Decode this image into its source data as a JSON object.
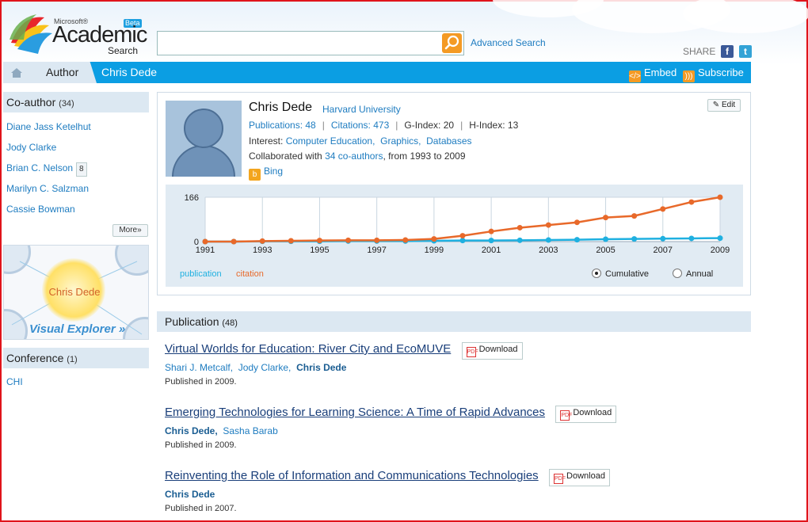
{
  "header": {
    "logo_ms": "Microsoft®",
    "logo_academic": "Academic",
    "logo_search": "Search",
    "logo_beta": "Beta",
    "search_value": "",
    "advanced_search": "Advanced Search",
    "share_label": "SHARE"
  },
  "nav": {
    "author": "Author",
    "current": "Chris Dede",
    "embed": "Embed",
    "subscribe": "Subscribe"
  },
  "sidebar": {
    "coauthor_title": "Co-author",
    "coauthor_count": "(34)",
    "coauthors": [
      {
        "name": "Diane Jass Ketelhut",
        "badge": ""
      },
      {
        "name": "Jody Clarke",
        "badge": ""
      },
      {
        "name": "Brian C. Nelson",
        "badge": "8"
      },
      {
        "name": "Marilyn C. Salzman",
        "badge": ""
      },
      {
        "name": "Cassie Bowman",
        "badge": ""
      }
    ],
    "more": "More»",
    "visual_center": "Chris Dede",
    "visual_label": "Visual Explorer »",
    "conference_title": "Conference",
    "conference_count": "(1)",
    "conference": "CHI"
  },
  "profile": {
    "name": "Chris Dede",
    "affiliation": "Harvard University",
    "edit": "Edit",
    "publications": "Publications: 48",
    "citations": "Citations: 473",
    "g_index": "G-Index: 20",
    "h_index": "H-Index: 13",
    "interest_label": "Interest:",
    "interests": [
      "Computer Education,",
      "Graphics,",
      "Databases"
    ],
    "collab_prefix": "Collaborated with",
    "collab_link": "34 co-authors",
    "collab_suffix": ", from 1993 to 2009",
    "bing": "Bing"
  },
  "chart_data": {
    "type": "line",
    "x": [
      1991,
      1992,
      1993,
      1994,
      1995,
      1996,
      1997,
      1998,
      1999,
      2000,
      2001,
      2002,
      2003,
      2004,
      2005,
      2006,
      2007,
      2008,
      2009
    ],
    "x_ticks": [
      "1991",
      "1993",
      "1995",
      "1997",
      "1999",
      "2001",
      "2003",
      "2005",
      "2007",
      "2009"
    ],
    "y_ticks": [
      "166",
      "0"
    ],
    "ylim": [
      0,
      166
    ],
    "mode": "Cumulative",
    "series": [
      {
        "name": "publication",
        "color": "#1fb0e0",
        "values": [
          0,
          0,
          1,
          1,
          1,
          2,
          2,
          2,
          3,
          4,
          4,
          5,
          6,
          7,
          9,
          10,
          11,
          12,
          13
        ]
      },
      {
        "name": "citation",
        "color": "#e8692a",
        "values": [
          0,
          0,
          2,
          3,
          4,
          5,
          5,
          6,
          10,
          22,
          38,
          52,
          62,
          72,
          90,
          96,
          122,
          148,
          166
        ]
      }
    ],
    "legend": [
      "publication",
      "citation"
    ],
    "options": [
      "Cumulative",
      "Annual"
    ],
    "grid": true
  },
  "publication": {
    "title": "Publication",
    "count": "(48)",
    "download": "Download",
    "items": [
      {
        "title": "Virtual Worlds for Education: River City and EcoMUVE",
        "authors": [
          "Shari J. Metcalf,",
          "Jody Clarke,",
          "Chris Dede"
        ],
        "bold": [
          false,
          false,
          true
        ],
        "published": "Published in 2009."
      },
      {
        "title": "Emerging Technologies for Learning Science: A Time of Rapid Advances",
        "authors": [
          "Chris Dede,",
          "Sasha Barab"
        ],
        "bold": [
          true,
          false
        ],
        "published": "Published in 2009."
      },
      {
        "title": "Reinventing the Role of Information and Communications Technologies",
        "authors": [
          "Chris Dede"
        ],
        "bold": [
          true
        ],
        "published": "Published in 2007."
      }
    ]
  }
}
